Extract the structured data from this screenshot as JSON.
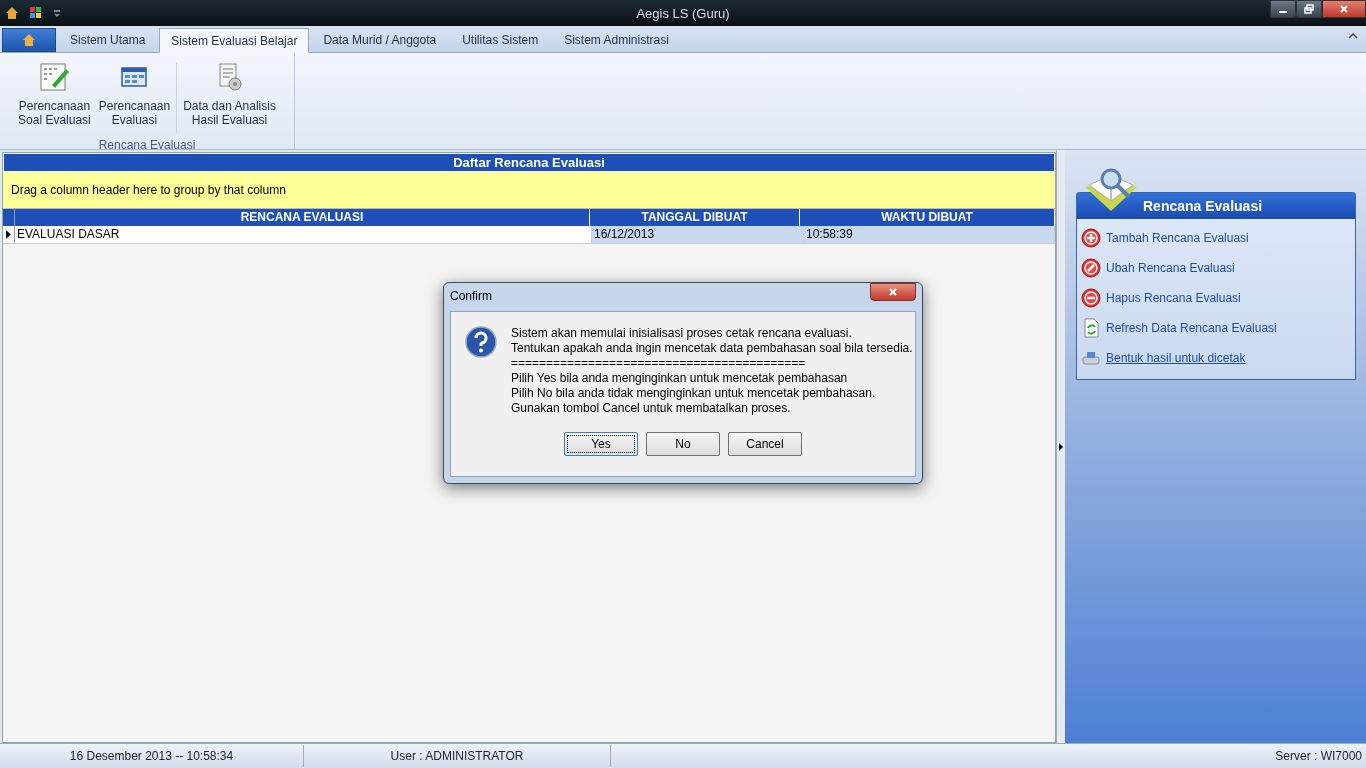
{
  "window": {
    "title": "Aegis LS (Guru)"
  },
  "tabs": [
    {
      "label": "Sistem Utama",
      "selected": false
    },
    {
      "label": "Sistem Evaluasi Belajar",
      "selected": true
    },
    {
      "label": "Data Murid / Anggota",
      "selected": false
    },
    {
      "label": "Utilitas Sistem",
      "selected": false
    },
    {
      "label": "Sistem Administrasi",
      "selected": false
    }
  ],
  "ribbon": {
    "group_label": "Rencana Evaluasi",
    "buttons": [
      {
        "kind": "sheet-edit",
        "lines": [
          "Perencanaan",
          "Soal Evaluasi"
        ]
      },
      {
        "kind": "table",
        "lines": [
          "Perencanaan",
          "Evaluasi"
        ]
      },
      {
        "kind": "report",
        "lines": [
          "Data dan Analisis",
          "Hasil Evaluasi"
        ]
      }
    ]
  },
  "grid": {
    "title": "Daftar Rencana Evaluasi",
    "group_hint": "Drag a column header here to group by that column",
    "columns": [
      "RENCANA EVALUASI",
      "TANGGAL DIBUAT",
      "WAKTU DIBUAT"
    ],
    "rows": [
      {
        "current": true,
        "cells": [
          "EVALUASI DASAR",
          "16/12/2013",
          "10:58:39"
        ]
      }
    ]
  },
  "side_panel": {
    "title": "Rencana Evaluasi",
    "links": [
      {
        "kind": "add",
        "label": "Tambah Rencana Evaluasi",
        "hovered": false
      },
      {
        "kind": "edit",
        "label": "Ubah Rencana Evaluasi",
        "hovered": false
      },
      {
        "kind": "delete",
        "label": "Hapus Rencana Evaluasi",
        "hovered": false
      },
      {
        "kind": "refresh",
        "label": "Refresh Data Rencana Evaluasi",
        "hovered": false
      },
      {
        "kind": "print",
        "label": "Bentuk hasil untuk dicetak",
        "hovered": true
      }
    ]
  },
  "dialog": {
    "title": "Confirm",
    "lines": [
      "Sistem akan memulai inisialisasi proses cetak rencana evaluasi.",
      "Tentukan apakah anda ingin mencetak data pembahasan soal bila tersedia.",
      "==========================================",
      "Pilih Yes bila anda menginginkan untuk mencetak pembahasan",
      "Pilih No bila anda tidak menginginkan untuk mencetak pembahasan.",
      "Gunakan tombol Cancel untuk membatalkan proses."
    ],
    "buttons": [
      {
        "label": "Yes",
        "focused": true
      },
      {
        "label": "No",
        "focused": false
      },
      {
        "label": "Cancel",
        "focused": false
      }
    ]
  },
  "status_bar": [
    "16 Desember 2013 -- 10:58:34",
    "User : ADMINISTRATOR",
    "Server : WI7000"
  ]
}
